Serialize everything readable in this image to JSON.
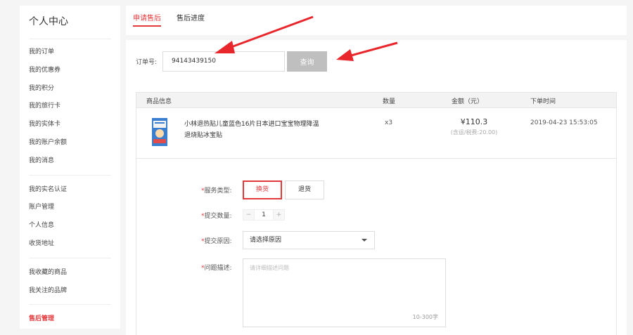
{
  "sidebar": {
    "title": "个人中心",
    "groups": [
      [
        "我的订单",
        "我的优惠券",
        "我的积分",
        "我的旅行卡",
        "我的实体卡",
        "我的账户余额",
        "我的消息"
      ],
      [
        "我的实名认证",
        "账户管理",
        "个人信息",
        "收货地址"
      ],
      [
        "我收藏的商品",
        "我关注的品牌"
      ],
      [
        "售后管理"
      ]
    ]
  },
  "tabs": [
    "申请售后",
    "售后进度"
  ],
  "order": {
    "label": "订单号:",
    "value": "94143439150",
    "query_button": "查询"
  },
  "table": {
    "headers": [
      "商品信息",
      "数量",
      "金额（元）",
      "下单时间"
    ],
    "product": {
      "name": "小林退热贴儿童蓝色16片日本进口宝宝物理降温退烧贴冰宝贴",
      "qty": "x3",
      "price": "¥110.3",
      "price_note": "(含运/税费:20.00)",
      "date": "2019-04-23 15:53:05"
    }
  },
  "form": {
    "service_label": "服务类型:",
    "service_options": [
      "换货",
      "退货"
    ],
    "quantity_label": "提交数量:",
    "quantity_minus": "−",
    "quantity_value": "1",
    "quantity_plus": "+",
    "reason_label": "提交原因:",
    "reason_value": "请选择原因",
    "desc_label": "问题描述:",
    "desc_placeholder": "请详细描述问题",
    "desc_counter": "10-300字",
    "required_mark": "*"
  },
  "colors": {
    "accent": "#e4393c",
    "button_gray": "#bfbfbf",
    "page_bg": "#f5f5f5"
  }
}
